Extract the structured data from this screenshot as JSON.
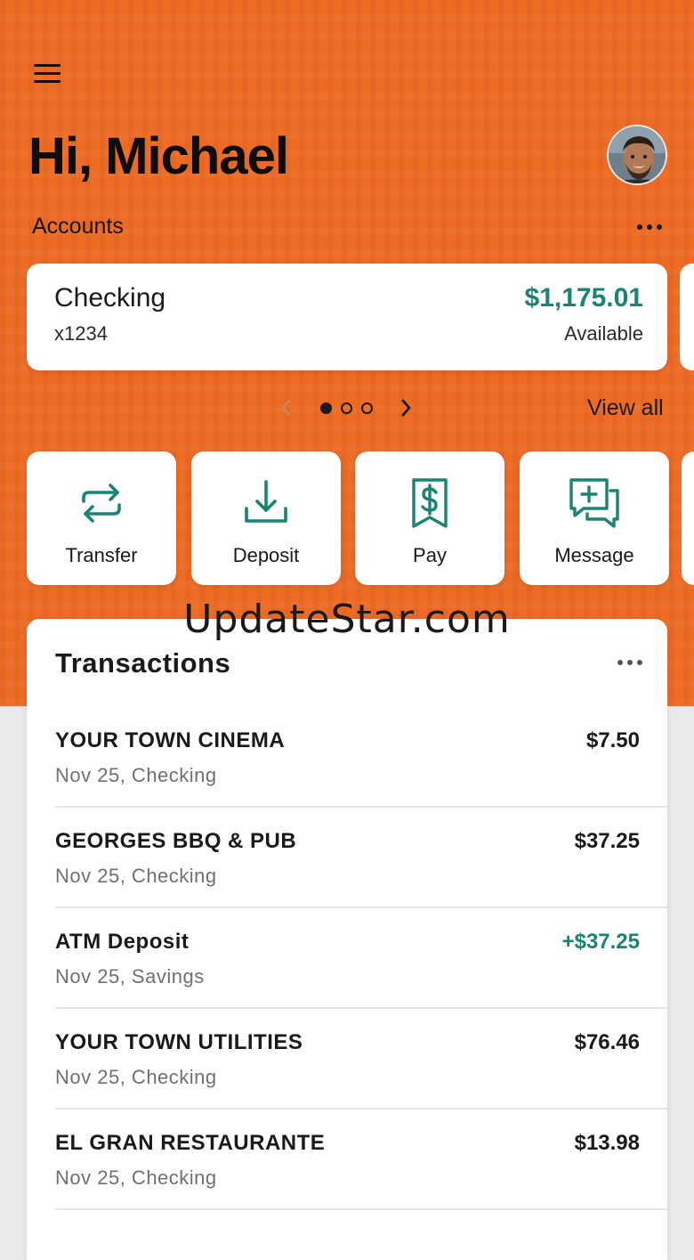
{
  "header": {
    "greeting": "Hi, Michael",
    "menu_icon": "hamburger-menu-icon",
    "avatar": "user-avatar-photo"
  },
  "accounts": {
    "label": "Accounts",
    "more_icon": "more-horizontal-icon",
    "card": {
      "name": "Checking",
      "number": "x1234",
      "balance": "$1,175.01",
      "balance_caption": "Available"
    },
    "pager": {
      "pages": 3,
      "current": 1
    },
    "view_all": "View all"
  },
  "actions": [
    {
      "label": "Transfer",
      "icon": "transfer-arrows-icon"
    },
    {
      "label": "Deposit",
      "icon": "deposit-download-icon"
    },
    {
      "label": "Pay",
      "icon": "bill-receipt-dollar-icon"
    },
    {
      "label": "Message",
      "icon": "message-plus-icon"
    }
  ],
  "watermark": "UpdateStar.com",
  "transactions": {
    "title": "Transactions",
    "more_icon": "more-horizontal-icon",
    "items": [
      {
        "name": "YOUR TOWN CINEMA",
        "meta": "Nov 25, Checking",
        "amount": "$7.50",
        "credit": false
      },
      {
        "name": "GEORGES BBQ & PUB",
        "meta": "Nov 25, Checking",
        "amount": "$37.25",
        "credit": false
      },
      {
        "name": "ATM Deposit",
        "meta": "Nov 25, Savings",
        "amount": "+$37.25",
        "credit": true
      },
      {
        "name": "YOUR TOWN UTILITIES",
        "meta": "Nov 25, Checking",
        "amount": "$76.46",
        "credit": false
      },
      {
        "name": "EL GRAN RESTAURANTE",
        "meta": "Nov 25, Checking",
        "amount": "$13.98",
        "credit": false
      }
    ]
  },
  "colors": {
    "brand_orange": "#ee6b24",
    "accent_teal": "#1a8473",
    "page_bg": "#e9eaec"
  }
}
